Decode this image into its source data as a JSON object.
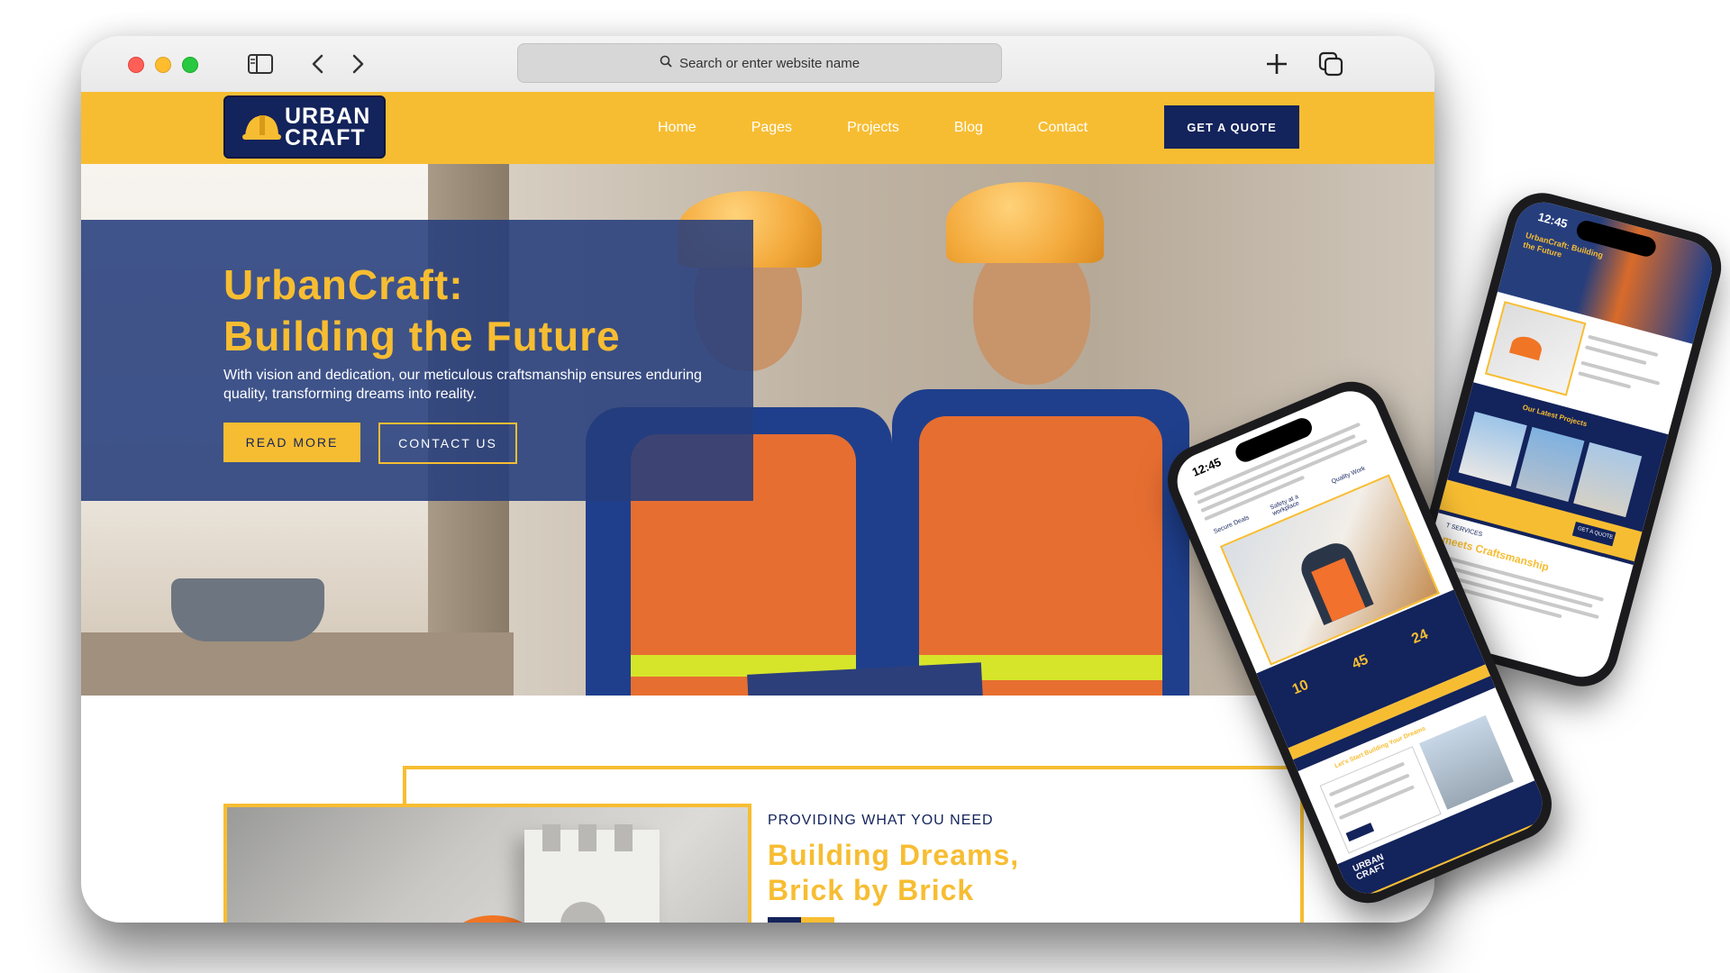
{
  "browser": {
    "address_placeholder": "Search or enter website name",
    "icons": [
      "sidebar-icon",
      "back-icon",
      "forward-icon",
      "search-icon",
      "new-tab-icon",
      "tabs-overview-icon"
    ]
  },
  "site": {
    "logo": {
      "line1": "URBAN",
      "line2": "CRAFT",
      "icon": "hard-hat-icon"
    },
    "nav": [
      "Home",
      "Pages",
      "Projects",
      "Blog",
      "Contact"
    ],
    "cta": "GET A QUOTE",
    "colors": {
      "primary_yellow": "#f7bd32",
      "navy": "#13235b",
      "hero_overlay": "#263e7c"
    }
  },
  "hero": {
    "title_line1": "UrbanCraft:",
    "title_line2": "Building the Future",
    "subtitle": "With vision and dedication, our meticulous craftsmanship ensures enduring quality, transforming dreams into reality.",
    "btn_read": "READ MORE",
    "btn_contact": "CONTACT US"
  },
  "about": {
    "kicker": "PROVIDING WHAT YOU NEED",
    "title_line1": "Building Dreams,",
    "title_line2": "Brick by Brick"
  },
  "phone_back": {
    "time": "12:45",
    "hero_title": "UrbanCraft: Building the Future",
    "projects_heading": "Our Latest Projects",
    "section_heading": "meets Craftsmanship",
    "services_kicker": "T SERVICES",
    "cta": "GET A QUOTE"
  },
  "phone_front": {
    "time": "12:45",
    "features": [
      "Secure Deals",
      "Safety at a workplace",
      "Quality Work"
    ],
    "stats": [
      "10",
      "45",
      "24"
    ],
    "contact_heading": "Let's Start Building Your Dreams",
    "logo_line1": "URBAN",
    "logo_line2": "CRAFT"
  }
}
